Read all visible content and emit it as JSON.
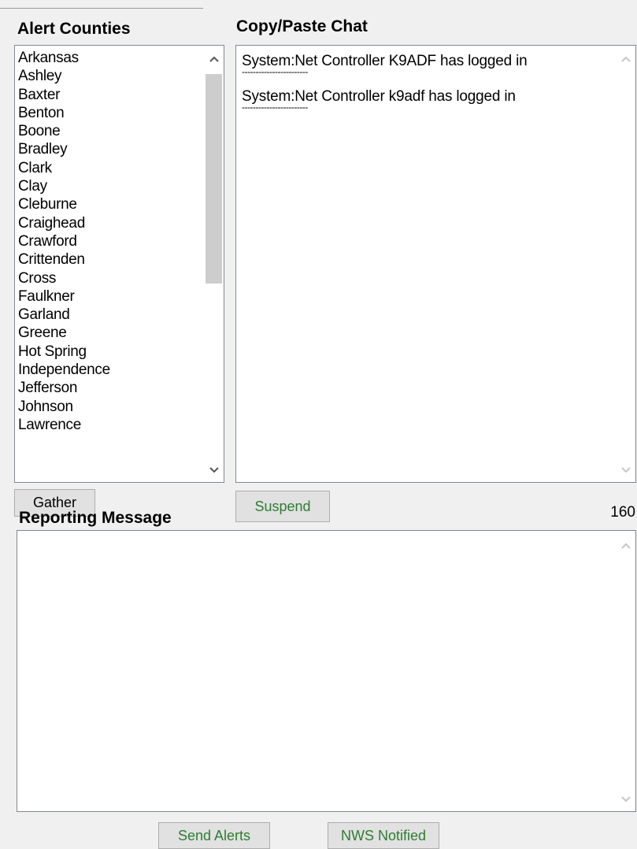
{
  "alert_counties": {
    "heading": "Alert Counties",
    "items": [
      "Arkansas",
      "Ashley",
      "Baxter",
      "Benton",
      "Boone",
      "Bradley",
      "Clark",
      "Clay",
      "Cleburne",
      "Craighead",
      "Crawford",
      "Crittenden",
      "Cross",
      "Faulkner",
      "Garland",
      "Greene",
      "Hot Spring",
      "Independence",
      "Jefferson",
      "Johnson",
      "Lawrence"
    ],
    "scroll_position": 0.0,
    "gather_label": "Gather"
  },
  "chat": {
    "heading": "Copy/Paste Chat",
    "messages": [
      {
        "text": "System:Net Controller K9ADF has logged in",
        "separator": "------------------------"
      },
      {
        "text": "System:Net Controller k9adf has logged in",
        "separator": "------------------------"
      }
    ],
    "suspend_label": "Suspend"
  },
  "reporting": {
    "heading": "Reporting Message",
    "char_count": "160",
    "message_value": ""
  },
  "footer": {
    "send_alerts_label": "Send Alerts",
    "nws_notified_label": "NWS Notified"
  },
  "colors": {
    "green_text": "#2e7d32",
    "button_bg": "#e1e1e1",
    "window_bg": "#f0f0f0"
  }
}
